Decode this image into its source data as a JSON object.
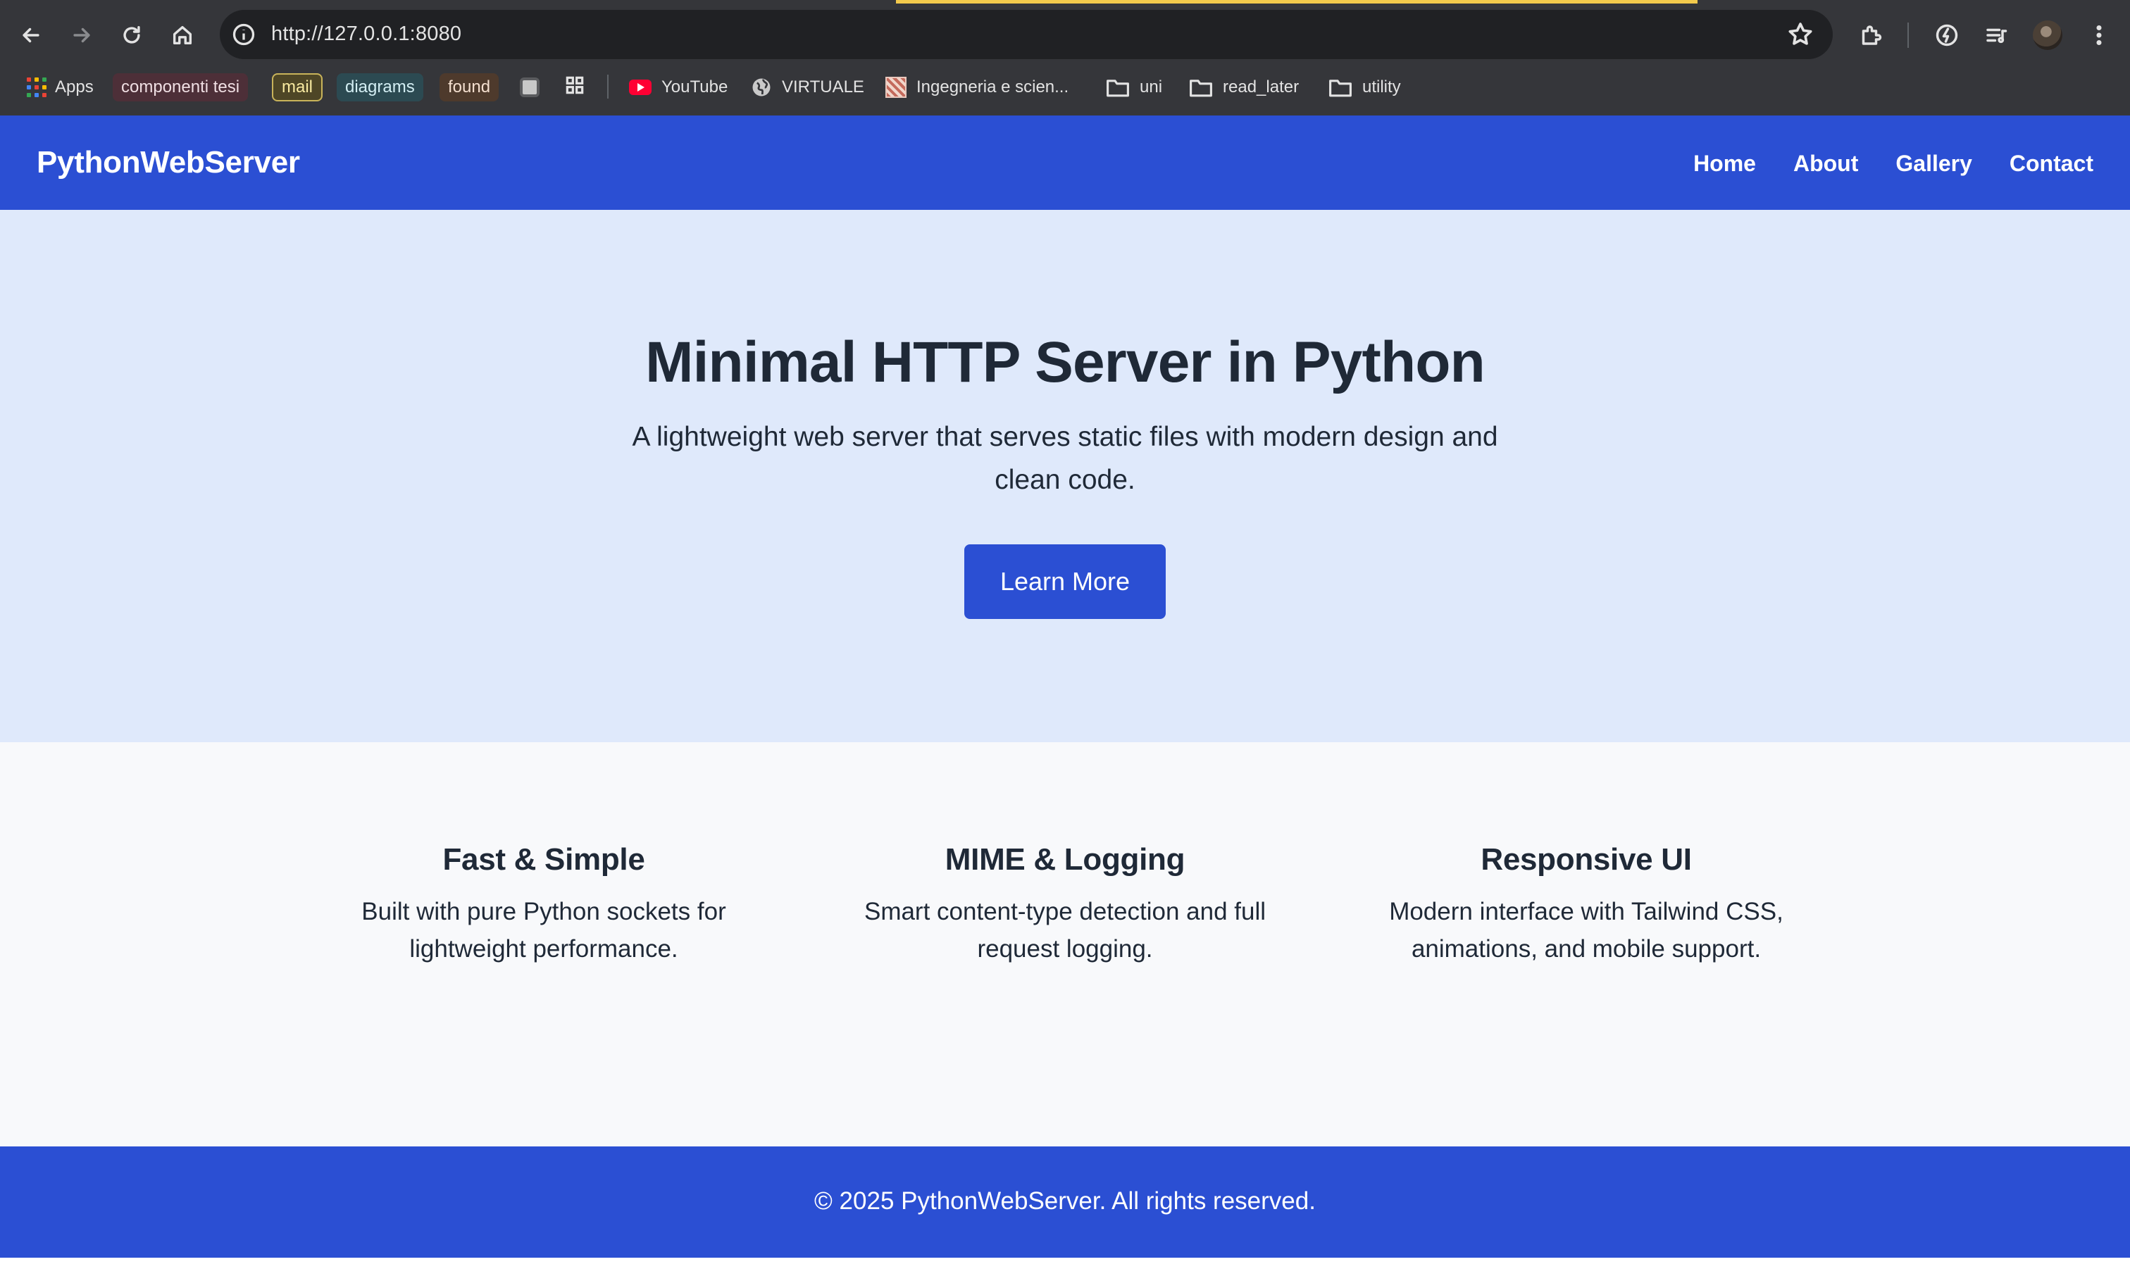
{
  "browser": {
    "url": "http://127.0.0.1:8080",
    "bookmarks": {
      "apps": "Apps",
      "componenti_tesi": "componenti tesi",
      "mail": "mail",
      "diagrams": "diagrams",
      "found": "found",
      "youtube": "YouTube",
      "virtuale": "VIRTUALE",
      "ingegneria": "Ingegneria e scien...",
      "uni": "uni",
      "read_later": "read_later",
      "utility": "utility"
    },
    "colors": {
      "toolbar": "#35363a",
      "omnibox": "#202124",
      "loading": "#f2c94c"
    }
  },
  "site": {
    "brand": "PythonWebServer",
    "nav": [
      "Home",
      "About",
      "Gallery",
      "Contact"
    ],
    "hero": {
      "title": "Minimal HTTP Server in Python",
      "subtitle": "A lightweight web server that serves static files with modern design and clean code.",
      "button": "Learn More"
    },
    "features": [
      {
        "title": "Fast & Simple",
        "text": "Built with pure Python sockets for lightweight performance."
      },
      {
        "title": "MIME & Logging",
        "text": "Smart content-type detection and full request logging."
      },
      {
        "title": "Responsive UI",
        "text": "Modern interface with Tailwind CSS, animations, and mobile support."
      }
    ],
    "footer": "© 2025 PythonWebServer. All rights reserved.",
    "colors": {
      "primary": "#2b4fd3",
      "hero_bg": "#dfe9fb",
      "features_bg": "#f8f9fb",
      "text": "#1f2937"
    }
  }
}
